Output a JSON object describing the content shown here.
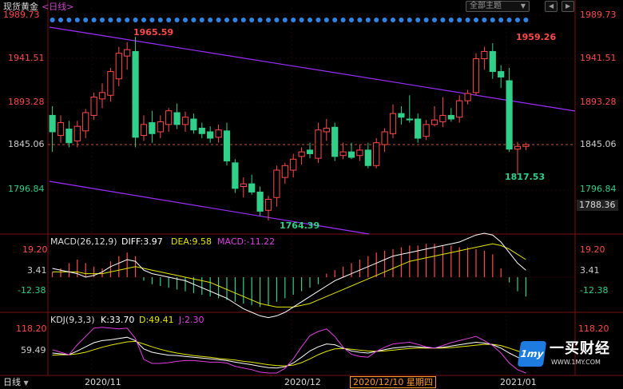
{
  "header": {
    "instrument": "现货黄金",
    "period_tag": "<日线>",
    "theme_button": "全部主题",
    "theme_chevron": "▼",
    "page_prev": "◀",
    "page_next": "▶"
  },
  "main": {
    "y_ticks": [
      "1989.73",
      "1941.51",
      "1893.28",
      "1845.06",
      "1796.84"
    ],
    "current_price": "1788.36",
    "ref_price": "1845.06",
    "annotations": {
      "high1": "1965.59",
      "high2": "1959.26",
      "low1": "1764.39",
      "low2": "1817.53"
    }
  },
  "macd": {
    "title": "MACD(26,12,9)",
    "diff_label": "DIFF:3.97",
    "dea_label": "DEA:9.58",
    "macd_label": "MACD:-11.22",
    "y_ticks": [
      "19.20",
      "3.41",
      "-12.38"
    ]
  },
  "kdj": {
    "title": "KDJ(9,3,3)",
    "k_label": "K:33.70",
    "d_label": "D:49.41",
    "j_label": "J:2.30",
    "y_ticks": [
      "118.20",
      "59.49"
    ]
  },
  "xaxis": {
    "period": "日线",
    "period_chevron": "▼",
    "labels": [
      "2020/11",
      "2020/12",
      "2021/01"
    ],
    "cursor_label": "2020/12/10 星期四"
  },
  "logo": {
    "badge": "1my",
    "name": "一买财经",
    "url": "WWW.1MY.COM"
  },
  "colors": {
    "up": "#ff4a4a",
    "down": "#31d08a",
    "diff": "#ffffff",
    "dea": "#e6e600",
    "macd_text": "#e040e0",
    "k": "#ffffff",
    "d": "#e6e600",
    "j": "#e040e0",
    "channel": "#9b30ff",
    "ref_line": "#ff6a3a"
  },
  "chart_data": {
    "type": "candlestick",
    "ylim": [
      1750,
      1995
    ],
    "candles": [
      [
        1880,
        1890,
        1840,
        1862
      ],
      [
        1858,
        1880,
        1850,
        1872
      ],
      [
        1865,
        1874,
        1845,
        1850
      ],
      [
        1852,
        1874,
        1845,
        1868
      ],
      [
        1863,
        1887,
        1855,
        1883
      ],
      [
        1880,
        1905,
        1875,
        1900
      ],
      [
        1898,
        1915,
        1888,
        1905
      ],
      [
        1902,
        1932,
        1895,
        1928
      ],
      [
        1920,
        1955,
        1912,
        1948
      ],
      [
        1945,
        1960,
        1930,
        1952
      ],
      [
        1950,
        1966,
        1845,
        1856
      ],
      [
        1858,
        1880,
        1852,
        1870
      ],
      [
        1872,
        1885,
        1850,
        1860
      ],
      [
        1862,
        1880,
        1855,
        1873
      ],
      [
        1870,
        1888,
        1862,
        1885
      ],
      [
        1883,
        1893,
        1865,
        1870
      ],
      [
        1870,
        1884,
        1862,
        1878
      ],
      [
        1876,
        1882,
        1860,
        1864
      ],
      [
        1866,
        1872,
        1855,
        1860
      ],
      [
        1862,
        1868,
        1850,
        1855
      ],
      [
        1856,
        1870,
        1850,
        1864
      ],
      [
        1863,
        1872,
        1825,
        1830
      ],
      [
        1828,
        1832,
        1795,
        1800
      ],
      [
        1802,
        1812,
        1790,
        1805
      ],
      [
        1805,
        1815,
        1793,
        1796
      ],
      [
        1796,
        1802,
        1770,
        1775
      ],
      [
        1776,
        1792,
        1765,
        1788
      ],
      [
        1790,
        1825,
        1780,
        1820
      ],
      [
        1812,
        1828,
        1805,
        1825
      ],
      [
        1820,
        1838,
        1812,
        1832
      ],
      [
        1835,
        1845,
        1826,
        1840
      ],
      [
        1842,
        1850,
        1833,
        1838
      ],
      [
        1833,
        1872,
        1828,
        1864
      ],
      [
        1862,
        1876,
        1852,
        1866
      ],
      [
        1867,
        1872,
        1830,
        1835
      ],
      [
        1836,
        1850,
        1832,
        1840
      ],
      [
        1840,
        1850,
        1832,
        1834
      ],
      [
        1836,
        1848,
        1830,
        1842
      ],
      [
        1842,
        1850,
        1822,
        1825
      ],
      [
        1825,
        1855,
        1822,
        1850
      ],
      [
        1848,
        1866,
        1840,
        1862
      ],
      [
        1860,
        1892,
        1855,
        1882
      ],
      [
        1882,
        1890,
        1870,
        1878
      ],
      [
        1876,
        1902,
        1872,
        1875
      ],
      [
        1876,
        1882,
        1850,
        1855
      ],
      [
        1857,
        1875,
        1853,
        1870
      ],
      [
        1870,
        1890,
        1868,
        1875
      ],
      [
        1873,
        1900,
        1867,
        1880
      ],
      [
        1880,
        1888,
        1873,
        1876
      ],
      [
        1878,
        1902,
        1872,
        1896
      ],
      [
        1896,
        1908,
        1892,
        1904
      ],
      [
        1905,
        1948,
        1902,
        1942
      ],
      [
        1942,
        1955,
        1930,
        1950
      ],
      [
        1950,
        1959,
        1920,
        1928
      ],
      [
        1928,
        1935,
        1910,
        1922
      ],
      [
        1918,
        1932,
        1840,
        1843
      ],
      [
        1843,
        1851,
        1815,
        1846
      ],
      [
        1846,
        1850,
        1842,
        1848
      ]
    ],
    "macd_hist": [
      3,
      5,
      8,
      10,
      8,
      6,
      5,
      9,
      12,
      14,
      12,
      -2,
      -4,
      -5,
      -6,
      -7,
      -8,
      -9,
      -10,
      -11,
      -12,
      -13,
      -14,
      -15,
      -16,
      -17,
      -16,
      -14,
      -12,
      -10,
      -8,
      -6,
      -4,
      2,
      4,
      6,
      8,
      10,
      12,
      14,
      15,
      16,
      17,
      18,
      18,
      19,
      19,
      18,
      18,
      17,
      17,
      16,
      15,
      13,
      5,
      -3,
      -8,
      -11
    ],
    "diff_line": [
      5,
      4,
      3,
      2,
      0,
      1,
      3,
      6,
      8,
      10,
      9,
      4,
      2,
      1,
      0,
      -1,
      -2,
      -4,
      -6,
      -8,
      -10,
      -12,
      -15,
      -18,
      -20,
      -22,
      -23,
      -22,
      -20,
      -17,
      -14,
      -11,
      -8,
      -5,
      -2,
      0,
      2,
      4,
      6,
      8,
      10,
      12,
      13,
      14,
      15,
      16,
      17,
      18,
      19,
      20,
      22,
      24,
      25,
      24,
      20,
      14,
      8,
      4
    ],
    "dea_line": [
      3,
      3,
      3,
      3,
      2,
      2,
      2,
      3,
      4,
      5,
      6,
      5,
      4,
      3,
      2,
      1,
      0,
      -1,
      -2,
      -3,
      -5,
      -7,
      -9,
      -11,
      -13,
      -15,
      -16,
      -17,
      -17,
      -17,
      -16,
      -15,
      -13,
      -11,
      -9,
      -7,
      -5,
      -3,
      -1,
      1,
      3,
      5,
      7,
      9,
      10,
      11,
      12,
      13,
      14,
      15,
      16,
      17,
      18,
      19,
      18,
      16,
      13,
      10
    ],
    "k_line": [
      50,
      48,
      46,
      55,
      65,
      75,
      80,
      82,
      85,
      88,
      80,
      60,
      52,
      48,
      45,
      44,
      42,
      40,
      38,
      36,
      34,
      32,
      28,
      25,
      22,
      18,
      15,
      14,
      17,
      26,
      40,
      55,
      65,
      72,
      70,
      62,
      55,
      52,
      50,
      54,
      58,
      62,
      64,
      66,
      65,
      63,
      62,
      64,
      67,
      70,
      73,
      76,
      74,
      70,
      62,
      50,
      40,
      34
    ],
    "d_line": [
      45,
      46,
      46,
      48,
      52,
      58,
      64,
      69,
      73,
      77,
      78,
      72,
      65,
      59,
      54,
      50,
      47,
      44,
      42,
      40,
      37,
      35,
      33,
      30,
      28,
      25,
      22,
      20,
      19,
      21,
      27,
      36,
      46,
      54,
      60,
      61,
      59,
      57,
      55,
      54,
      55,
      57,
      59,
      61,
      62,
      62,
      62,
      62,
      63,
      65,
      67,
      69,
      71,
      71,
      68,
      62,
      55,
      49
    ],
    "j_line": [
      58,
      52,
      46,
      70,
      90,
      110,
      112,
      110,
      108,
      110,
      85,
      35,
      25,
      25,
      27,
      30,
      32,
      32,
      30,
      28,
      28,
      26,
      18,
      14,
      10,
      4,
      2,
      2,
      13,
      36,
      65,
      92,
      102,
      108,
      90,
      64,
      47,
      42,
      40,
      54,
      64,
      72,
      74,
      76,
      71,
      65,
      62,
      68,
      75,
      80,
      85,
      90,
      80,
      68,
      50,
      26,
      10,
      2
    ]
  }
}
